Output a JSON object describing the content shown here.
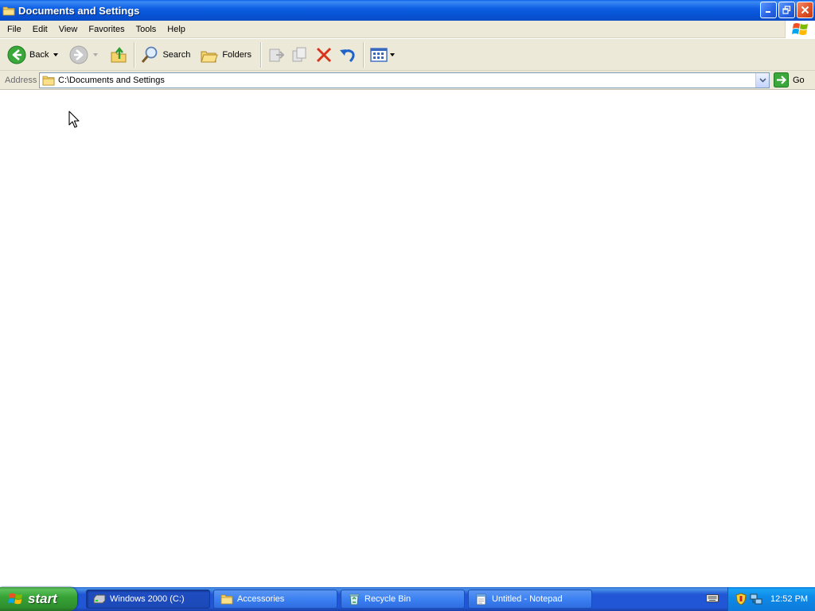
{
  "window": {
    "title": "Documents and Settings",
    "icon": "folder-icon"
  },
  "menubar": {
    "items": [
      "File",
      "Edit",
      "View",
      "Favorites",
      "Tools",
      "Help"
    ]
  },
  "toolbar": {
    "back_label": "Back",
    "search_label": "Search",
    "folders_label": "Folders"
  },
  "address": {
    "label": "Address",
    "value": "C:\\Documents and Settings",
    "go_label": "Go"
  },
  "taskbar": {
    "start_label": "start",
    "tasks": [
      {
        "label": "Windows 2000 (C:)",
        "icon": "drive-icon",
        "active": true
      },
      {
        "label": "Accessories",
        "icon": "folder-icon",
        "active": false
      },
      {
        "label": "Recycle Bin",
        "icon": "recycle-bin-icon",
        "active": false
      },
      {
        "label": "Untitled - Notepad",
        "icon": "notepad-icon",
        "active": false
      }
    ],
    "clock": "12:52 PM"
  },
  "colors": {
    "titlebar": "#0653d6",
    "chrome": "#ece9d8",
    "taskbar": "#2157d7",
    "start": "#37a336",
    "tray": "#0f8ae8"
  }
}
